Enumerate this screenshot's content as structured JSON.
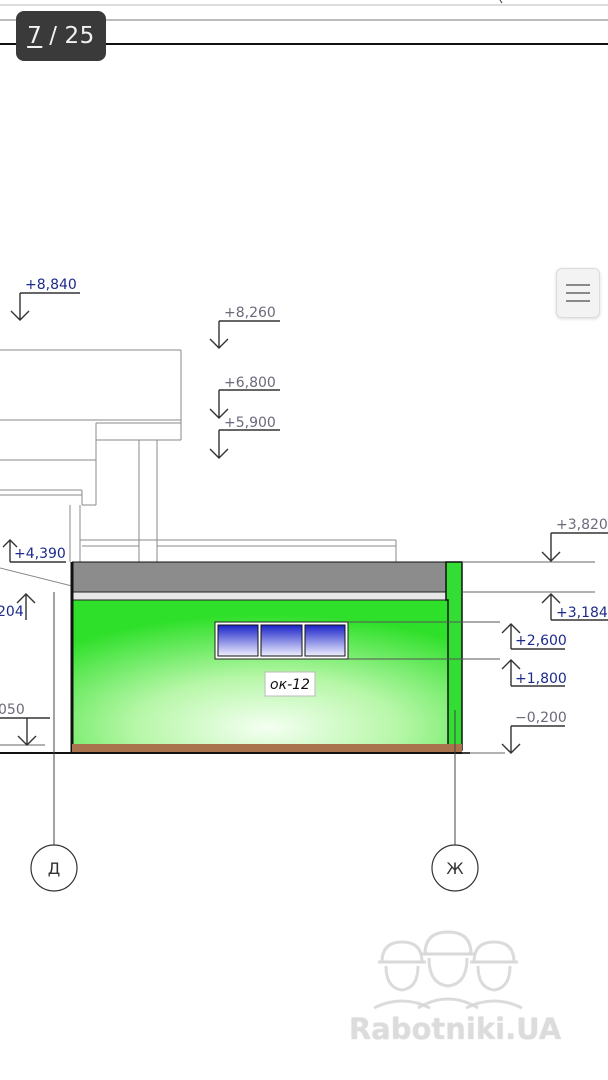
{
  "viewer": {
    "page_current": "7",
    "page_separator": "/",
    "page_total": "25"
  },
  "drawing": {
    "levels": [
      {
        "id": "l8840",
        "label": "+8,840",
        "color": "#1c2a8c"
      },
      {
        "id": "l8260",
        "label": "+8,260",
        "color": "#6a6a7a"
      },
      {
        "id": "l6800",
        "label": "+6,800",
        "color": "#6a6a7a"
      },
      {
        "id": "l5900",
        "label": "+5,900",
        "color": "#6a6a7a"
      },
      {
        "id": "l3820",
        "label": "+3,820",
        "color": "#6a6a7a"
      },
      {
        "id": "l4390",
        "label": "+4,390",
        "color": "#1c2a8c"
      },
      {
        "id": "l3184",
        "label": "+3,184",
        "color": "#1c2a8c"
      },
      {
        "id": "l204",
        "label": "204",
        "color": "#1c2a8c"
      },
      {
        "id": "l2600",
        "label": "+2,600",
        "color": "#1c2a8c"
      },
      {
        "id": "l1800",
        "label": "+1,800",
        "color": "#1c2a8c"
      },
      {
        "id": "l050",
        "label": "050",
        "color": "#6a6a7a"
      },
      {
        "id": "lm0200",
        "label": "−0,200",
        "color": "#6a6a7a"
      }
    ],
    "window_tag": "ок-12",
    "axes": [
      "Д",
      "Ж"
    ],
    "fill_color": "#33e033",
    "slab_color": "#8c8c8c"
  },
  "watermark": {
    "text": "Rabotniki.UA"
  }
}
